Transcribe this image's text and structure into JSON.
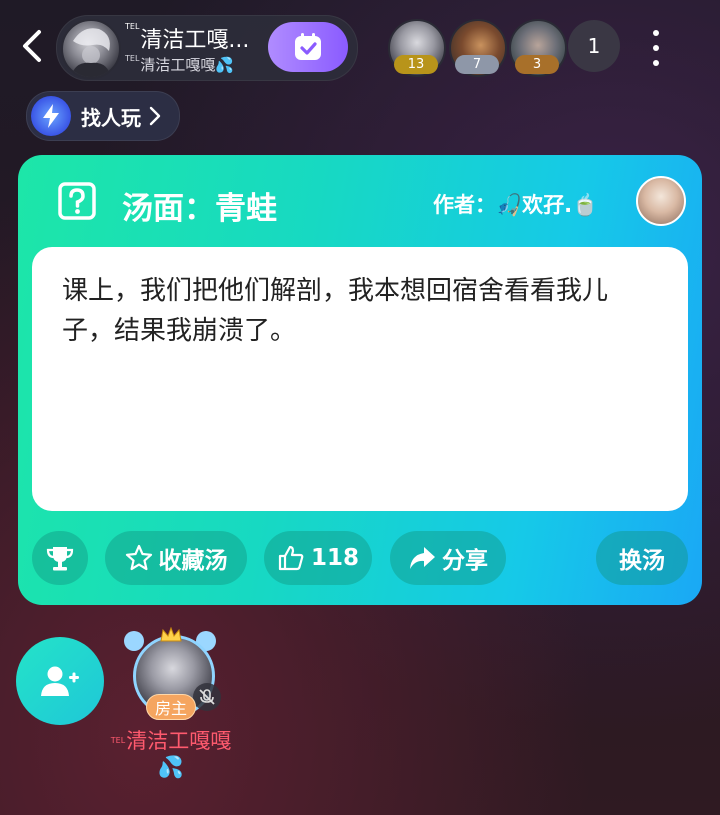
{
  "header": {
    "room_title": "清洁工嘎...",
    "room_subtitle": "清洁工嘎嘎💦",
    "tel_tag": "TEL",
    "audience": [
      {
        "name": "audience-1",
        "badge": "13",
        "badge_color": "#b8941a"
      },
      {
        "name": "audience-2",
        "badge": "7",
        "badge_color": "#8e97a8"
      },
      {
        "name": "audience-3",
        "badge": "3",
        "badge_color": "#a8702a"
      }
    ],
    "online_count": "1"
  },
  "find_players": {
    "label": "找人玩"
  },
  "card": {
    "title": "汤面：青蛙",
    "author_label": "作者：🎣欢孖.🍵",
    "story": "课上，我们把他们解剖，我本想回宿舍看看我儿子，结果我崩溃了。",
    "actions": {
      "collect": "收藏汤",
      "likes": "118",
      "share": "分享",
      "change": "换汤"
    }
  },
  "seat": {
    "host_badge": "房主",
    "host_name": "清洁工嘎嘎💦",
    "tel_tag": "TEL"
  },
  "colors": {
    "card_start": "#1de6a8",
    "card_end": "#1aa8f5",
    "check_button": "#9b72ff",
    "host_name": "#ff5a6e",
    "host_badge": "#f5a560"
  }
}
